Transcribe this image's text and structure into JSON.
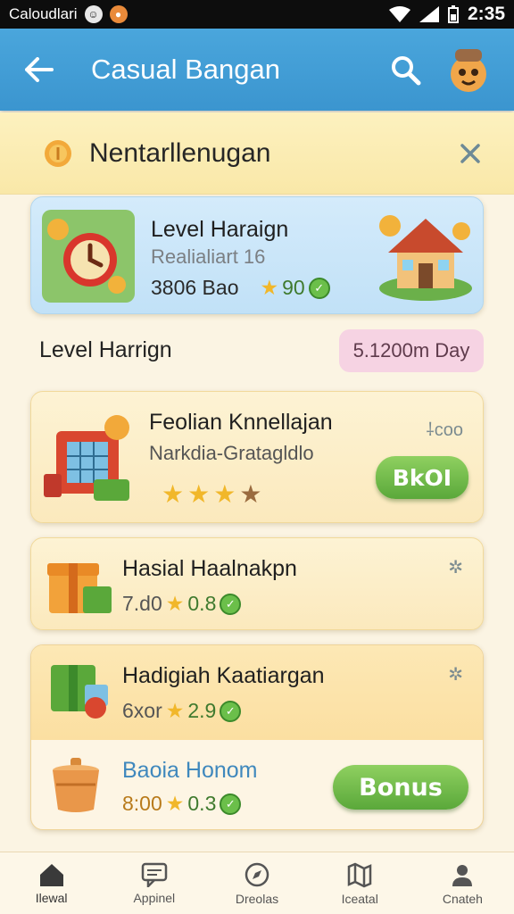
{
  "status_bar": {
    "carrier": "Caloudlari",
    "time": "2:35"
  },
  "app_bar": {
    "title": "Casual Bangan",
    "back_icon": "arrow-left-icon",
    "search_icon": "search-icon",
    "avatar_icon": "mascot-avatar-icon"
  },
  "banner": {
    "title": "Nentarllenugan",
    "icon": "coin-icon",
    "close_icon": "close-icon"
  },
  "featured_card": {
    "title": "Level Haraign",
    "subtitle": "Realialiart 16",
    "value": "3806 Bao",
    "stars_value": "90"
  },
  "level_row": {
    "label": "Level Harrign",
    "pill": "5.1200m Day"
  },
  "cards": [
    {
      "title": "Feolian Knnellajan",
      "subtitle": "Narkdia-Gratagldlo",
      "corner": "⸸coo",
      "button": "BkOI",
      "rating": 4
    },
    {
      "title": "Hasial Haalnakpn",
      "value": "7.d0",
      "points": "0.8",
      "corner": "✲"
    },
    {
      "title": "Hadigiah Kaatiargan",
      "value": "6xor",
      "points": "2.9",
      "corner": "✲"
    }
  ],
  "bonus_row": {
    "title": "Baoia Honom",
    "value": "8:00",
    "points": "0.3",
    "button": "Bonus"
  },
  "bottom_nav": [
    {
      "label": "Ilewal",
      "icon": "home-icon"
    },
    {
      "label": "Appinel",
      "icon": "chat-icon"
    },
    {
      "label": "Dreolas",
      "icon": "compass-icon"
    },
    {
      "label": "Iceatal",
      "icon": "map-icon"
    },
    {
      "label": "Cnateh",
      "icon": "profile-icon"
    }
  ],
  "colors": {
    "app_bar": "#3b95cf",
    "banner": "#fbe9a8",
    "accent_green": "#5aa83a",
    "pill": "#f6d3e3"
  }
}
